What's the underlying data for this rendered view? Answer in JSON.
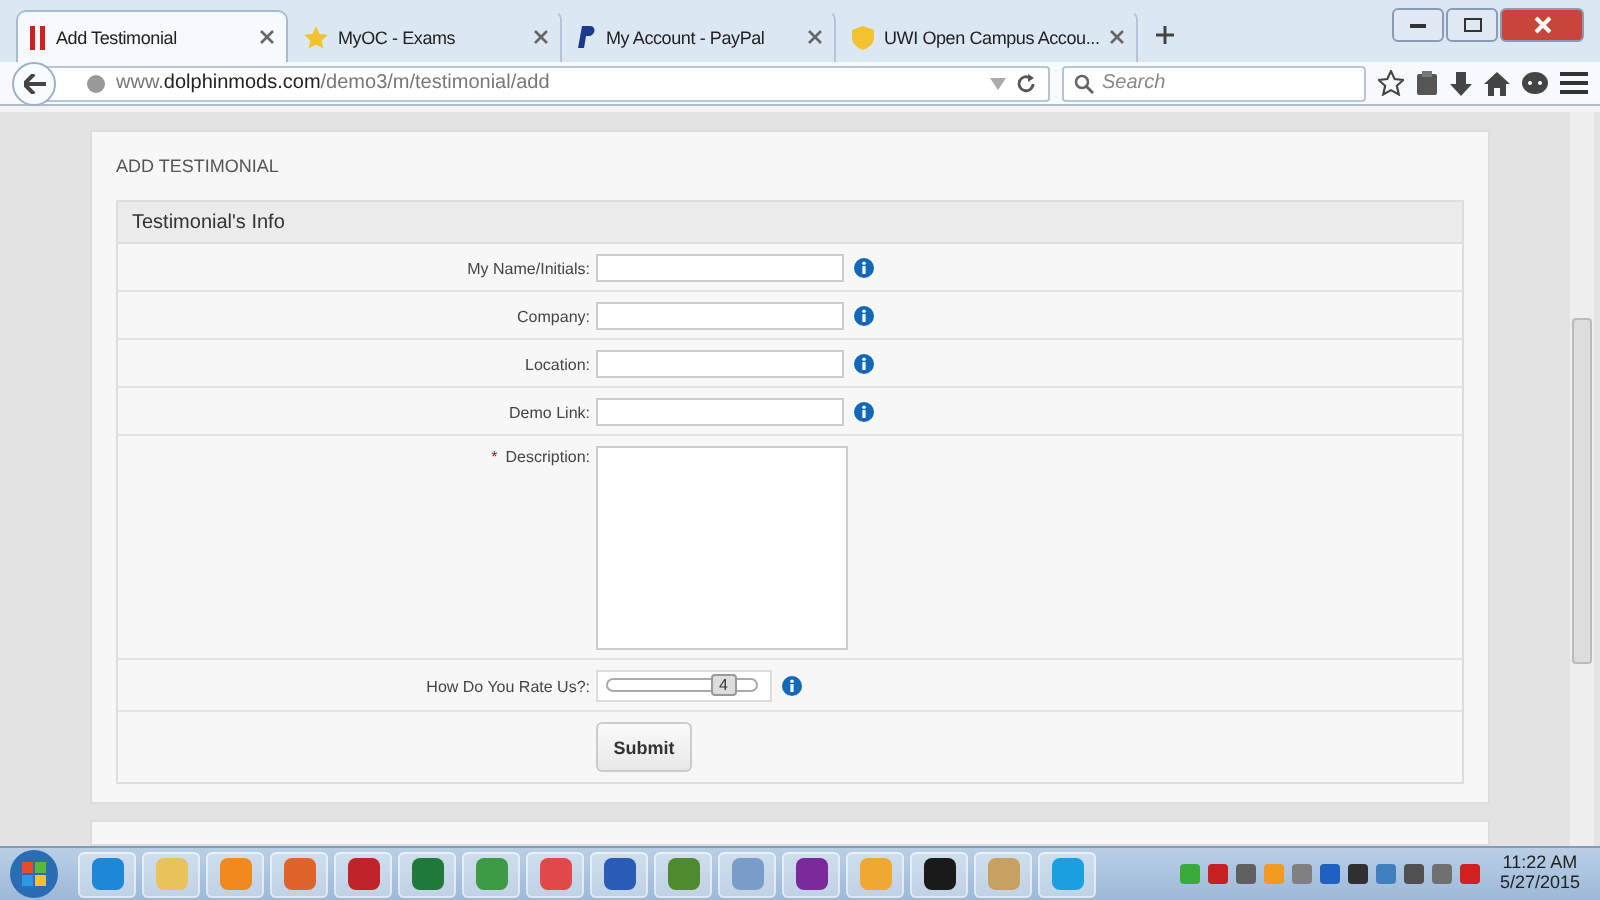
{
  "browser": {
    "tabs": [
      {
        "title": "Add Testimonial",
        "kind": "bars",
        "selected": true
      },
      {
        "title": "MyOC - Exams",
        "kind": "star",
        "selected": false
      },
      {
        "title": "My Account - PayPal",
        "kind": "paypal",
        "selected": false
      },
      {
        "title": "UWI Open Campus Accou...",
        "kind": "shield",
        "selected": false
      }
    ],
    "url": "www.**dolphinmods.com**/demo3/m/testimonial/add",
    "search_placeholder": "Search"
  },
  "page": {
    "heading": "ADD TESTIMONIAL",
    "section_title": "Testimonial's Info",
    "fields": [
      {
        "label": "My Name/Initials:",
        "kind": "text"
      },
      {
        "label": "Company:",
        "kind": "text"
      },
      {
        "label": "Location:",
        "kind": "text"
      },
      {
        "label": "Demo Link:",
        "kind": "text"
      },
      {
        "label": "Description:",
        "kind": "textarea",
        "marker": "*"
      },
      {
        "label": "How Do You Rate Us?:",
        "kind": "slider",
        "value": "4",
        "level": 0.78
      }
    ],
    "submit": "Submit"
  },
  "taskbar": {
    "apps": [
      {
        "color": "#1e88d8"
      },
      {
        "color": "#e8c25a"
      },
      {
        "color": "#f08a1c"
      },
      {
        "color": "#e0632a"
      },
      {
        "color": "#c0242a"
      },
      {
        "color": "#1f7a3a"
      },
      {
        "color": "#3d9b45"
      },
      {
        "color": "#e04a4a"
      },
      {
        "color": "#2a5bb5"
      },
      {
        "color": "#4f8a2e"
      },
      {
        "color": "#7a9cc8"
      },
      {
        "color": "#7a2a9a"
      },
      {
        "color": "#f0a830"
      },
      {
        "color": "#1a1a1a"
      },
      {
        "color": "#c8a060"
      },
      {
        "color": "#1aa0e0"
      }
    ],
    "tray": [
      {
        "color": "#3aaa3a"
      },
      {
        "color": "#c82020"
      },
      {
        "color": "#606060"
      },
      {
        "color": "#f09a20"
      },
      {
        "color": "#808080"
      },
      {
        "color": "#2060c0"
      },
      {
        "color": "#303030"
      },
      {
        "color": "#4080c0"
      },
      {
        "color": "#505050"
      },
      {
        "color": "#707070"
      },
      {
        "color": "#d02020"
      }
    ],
    "time": "11:22 AM",
    "date": "5/27/2015"
  }
}
